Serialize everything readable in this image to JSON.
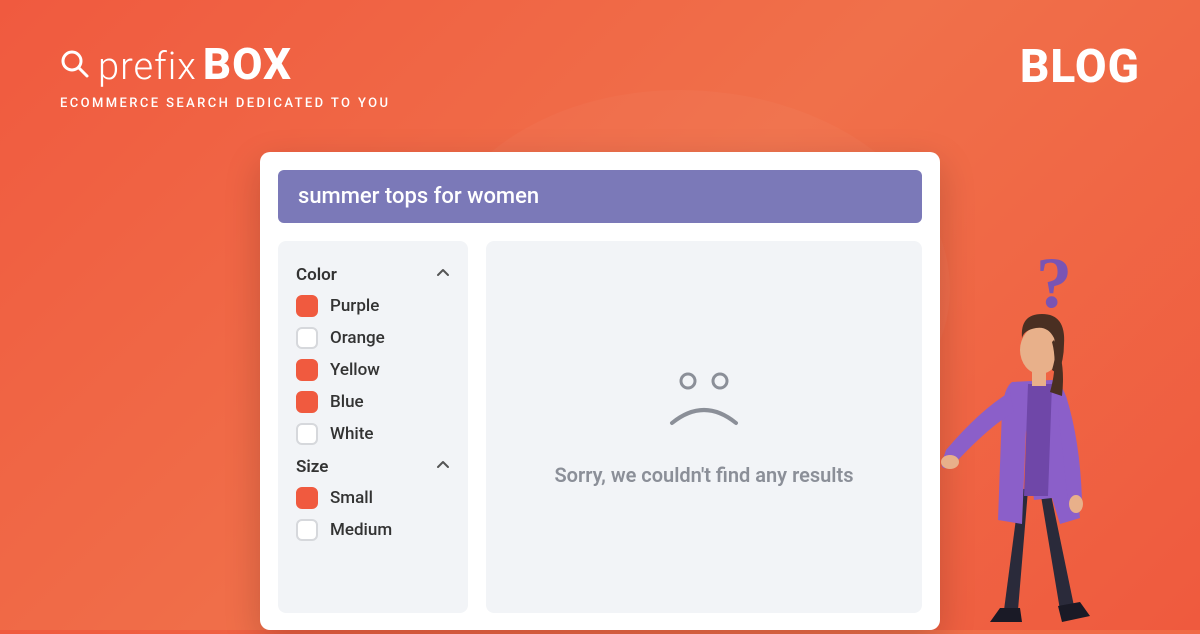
{
  "logo": {
    "prefix": "prefix",
    "box": "BOX",
    "tagline": "ECOMMERCE SEARCH DEDICATED TO YOU"
  },
  "header": {
    "blog_label": "BLOG"
  },
  "search": {
    "value": "summer tops for women"
  },
  "sidebar": {
    "groups": [
      {
        "title": "Color",
        "items": [
          {
            "label": "Purple",
            "checked": true
          },
          {
            "label": "Orange",
            "checked": false
          },
          {
            "label": "Yellow",
            "checked": true
          },
          {
            "label": "Blue",
            "checked": true
          },
          {
            "label": "White",
            "checked": false
          }
        ]
      },
      {
        "title": "Size",
        "items": [
          {
            "label": "Small",
            "checked": true
          },
          {
            "label": "Medium",
            "checked": false
          }
        ]
      }
    ]
  },
  "results": {
    "empty_message": "Sorry, we couldn't find any results"
  },
  "illustration": {
    "question_mark": "?"
  },
  "colors": {
    "accent": "#f05a3f",
    "search_bar": "#7b79b8",
    "panel": "#f2f4f7",
    "muted_text": "#8b8f98",
    "purple": "#7a54b3"
  }
}
